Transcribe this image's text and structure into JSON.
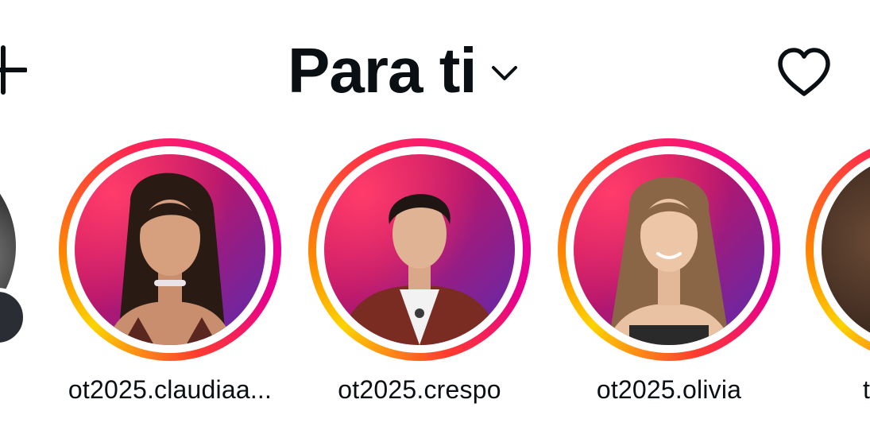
{
  "header": {
    "feed_title": "Para ti",
    "add_icon": "plus-icon",
    "dropdown_icon": "chevron-down-icon",
    "activity_icon": "heart-icon"
  },
  "stories": [
    {
      "username": "ot2025.claudiaa..."
    },
    {
      "username": "ot2025.crespo"
    },
    {
      "username": "ot2025.olivia"
    },
    {
      "username": "t"
    }
  ],
  "colors": {
    "text": "#0a0f14",
    "ring_yellow": "#fcd300",
    "ring_orange": "#ff8a00",
    "ring_pink": "#ee00a8",
    "background": "#ffffff"
  }
}
